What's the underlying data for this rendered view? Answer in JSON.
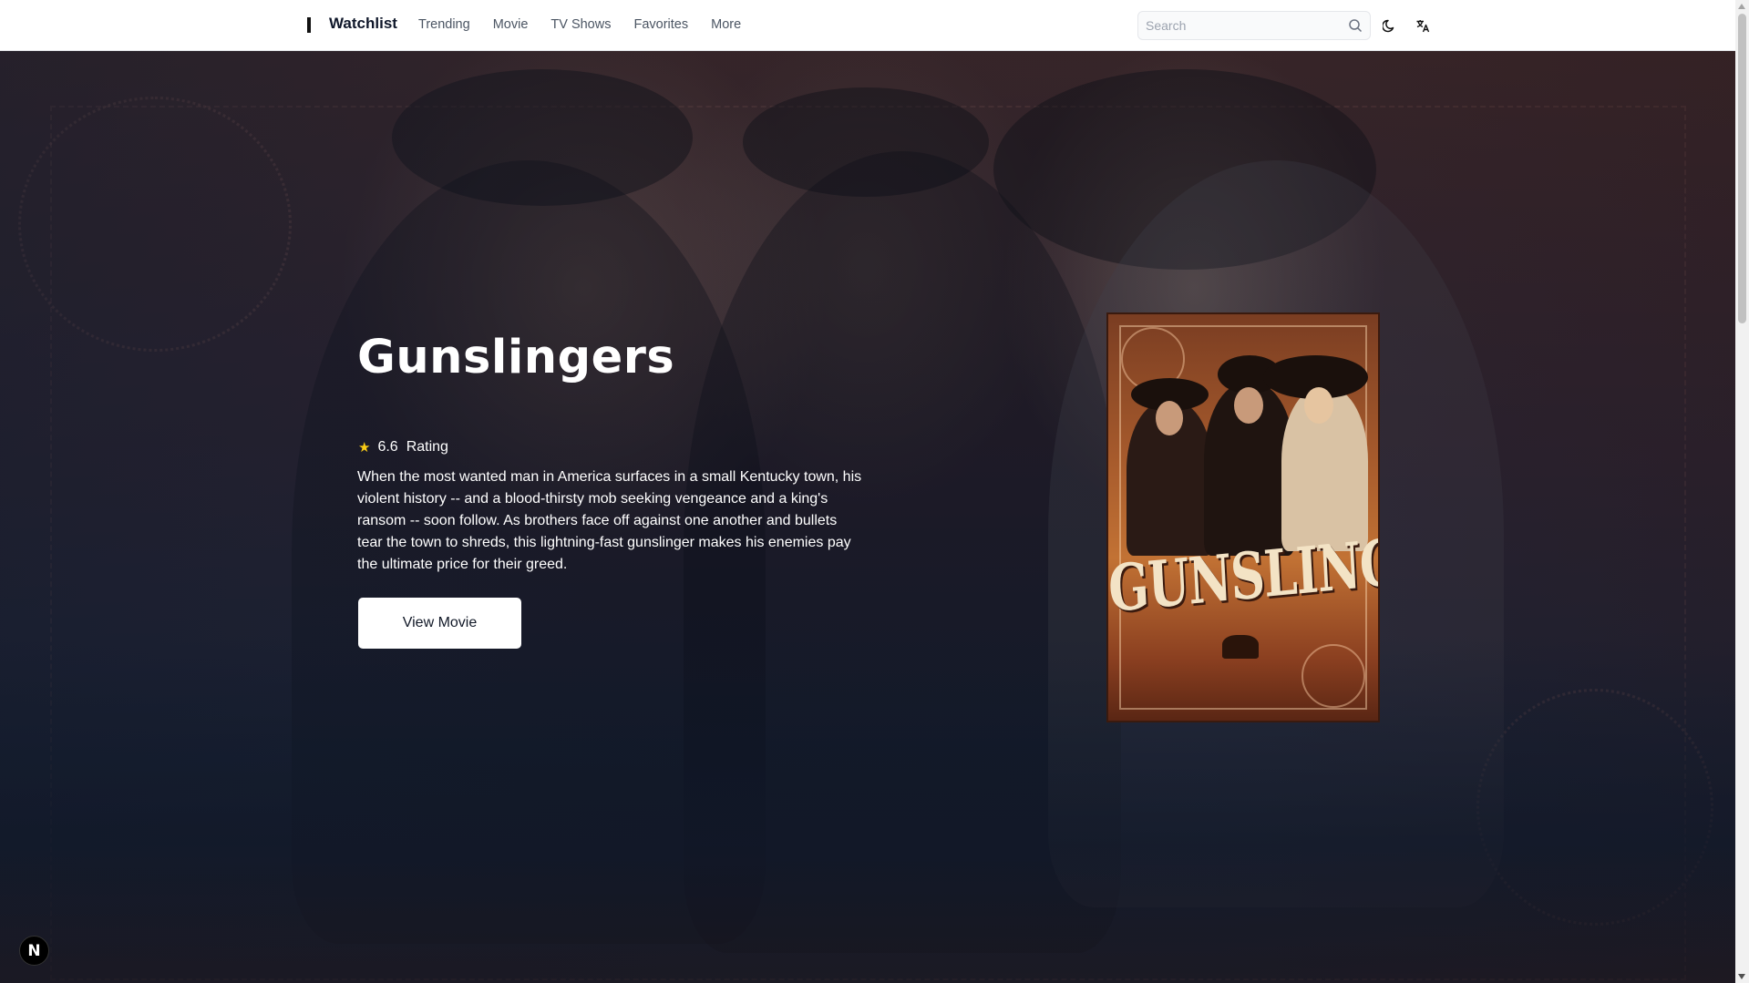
{
  "header": {
    "brand": "Watchlist",
    "nav": [
      "Trending",
      "Movie",
      "TV Shows",
      "Favorites",
      "More"
    ],
    "search_placeholder": "Search"
  },
  "hero": {
    "title": "Gunslingers",
    "rating_value": "6.6",
    "rating_label": "Rating",
    "overview": "When the most wanted man in America surfaces in a small Kentucky town, his violent history -- and a blood-thirsty mob seeking vengeance and a king's ransom -- soon follow. As brothers face off against one another and bullets tear the town to shreds, this lightning-fast gunslinger makes his enemies pay the ultimate price for their greed.",
    "button_label": "View Movie",
    "poster_text": "GUNSLINGERS"
  },
  "badge": {
    "letter": "N"
  },
  "colors": {
    "star": "#facc15",
    "hero_top": "#3b2628",
    "hero_bottom": "#171f30",
    "poster": "#a65a2c"
  }
}
